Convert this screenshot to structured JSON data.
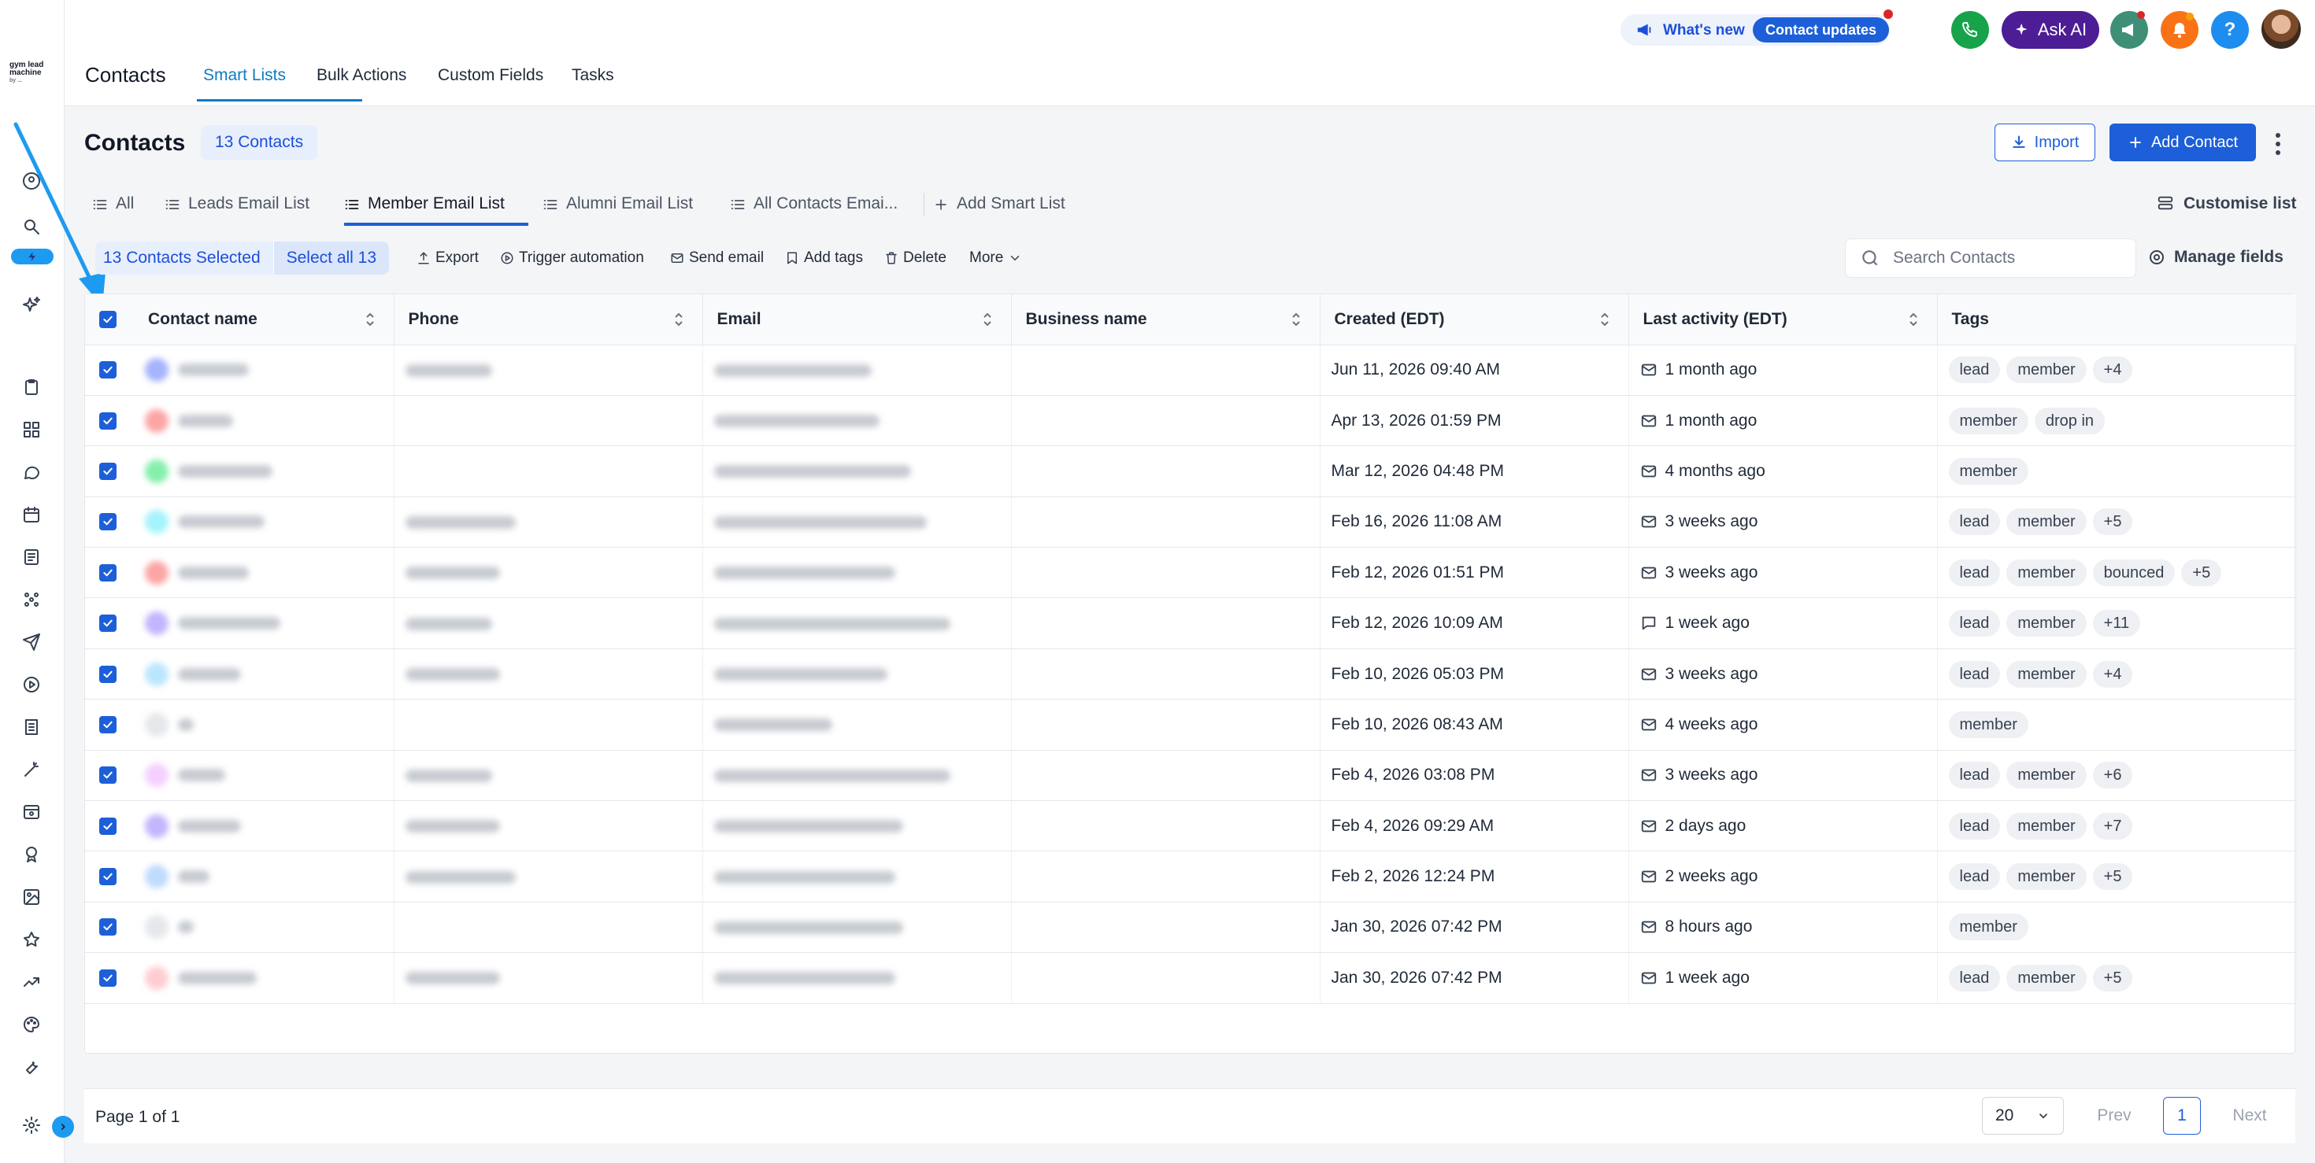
{
  "brand": {
    "logo_line1": "gym lead",
    "logo_line2": "machine",
    "logo_sub": "by ..."
  },
  "header": {
    "title": "Contacts",
    "tabs": [
      {
        "label": "Smart Lists",
        "active": true
      },
      {
        "label": "Bulk Actions"
      },
      {
        "label": "Custom Fields"
      },
      {
        "label": "Tasks"
      }
    ],
    "whats_new": "What's new",
    "contact_updates": "Contact updates",
    "ask_ai": "Ask AI",
    "colors": {
      "phone": "#16a34a",
      "ai": "#4c1d95",
      "megaphone": "#3f8f78",
      "bell": "#f97316",
      "help": "#1d8df0"
    }
  },
  "page": {
    "title": "Contacts",
    "count_badge": "13 Contacts",
    "import_label": "Import",
    "add_label": "Add Contact",
    "customise_label": "Customise list"
  },
  "smart_lists": [
    {
      "label": "All"
    },
    {
      "label": "Leads Email List"
    },
    {
      "label": "Member Email List",
      "active": true
    },
    {
      "label": "Alumni Email List"
    },
    {
      "label": "All Contacts Emai..."
    },
    {
      "label": "Add Smart List"
    }
  ],
  "actions": {
    "selected_label": "13 Contacts Selected",
    "select_all_label": "Select all 13",
    "export": "Export",
    "trigger_automation": "Trigger automation",
    "send_email": "Send email",
    "add_tags": "Add tags",
    "delete": "Delete",
    "more": "More",
    "search_placeholder": "Search Contacts",
    "manage_fields": "Manage fields"
  },
  "table": {
    "columns": [
      "Contact name",
      "Phone",
      "Email",
      "Business name",
      "Created (EDT)",
      "Last activity (EDT)",
      "Tags"
    ],
    "rows": [
      {
        "created": "Jun 11, 2026 09:40 AM",
        "activity": "1 month ago",
        "activity_icon": "mail-icon",
        "tags": [
          "lead",
          "member",
          "+4"
        ],
        "avatar": "#a5b4fc"
      },
      {
        "created": "Apr 13, 2026 01:59 PM",
        "activity": "1 month ago",
        "activity_icon": "mail-icon",
        "tags": [
          "member",
          "drop in"
        ],
        "avatar": "#fca5a5"
      },
      {
        "created": "Mar 12, 2026 04:48 PM",
        "activity": "4 months ago",
        "activity_icon": "mail-icon",
        "tags": [
          "member"
        ],
        "avatar": "#86efac"
      },
      {
        "created": "Feb 16, 2026 11:08 AM",
        "activity": "3 weeks ago",
        "activity_icon": "mail-icon",
        "tags": [
          "lead",
          "member",
          "+5"
        ],
        "avatar": "#a5f3fc"
      },
      {
        "created": "Feb 12, 2026 01:51 PM",
        "activity": "3 weeks ago",
        "activity_icon": "mail-icon",
        "tags": [
          "lead",
          "member",
          "bounced",
          "+5"
        ],
        "avatar": "#fca5a5"
      },
      {
        "created": "Feb 12, 2026 10:09 AM",
        "activity": "1 week ago",
        "activity_icon": "chat-icon",
        "tags": [
          "lead",
          "member",
          "+11"
        ],
        "avatar": "#c4b5fd"
      },
      {
        "created": "Feb 10, 2026 05:03 PM",
        "activity": "3 weeks ago",
        "activity_icon": "mail-icon",
        "tags": [
          "lead",
          "member",
          "+4"
        ],
        "avatar": "#bae6fd"
      },
      {
        "created": "Feb 10, 2026 08:43 AM",
        "activity": "4 weeks ago",
        "activity_icon": "mail-icon",
        "tags": [
          "member"
        ],
        "avatar": "#e5e7eb"
      },
      {
        "created": "Feb 4, 2026 03:08 PM",
        "activity": "3 weeks ago",
        "activity_icon": "mail-icon",
        "tags": [
          "lead",
          "member",
          "+6"
        ],
        "avatar": "#f5d0fe"
      },
      {
        "created": "Feb 4, 2026 09:29 AM",
        "activity": "2 days ago",
        "activity_icon": "mail-icon",
        "tags": [
          "lead",
          "member",
          "+7"
        ],
        "avatar": "#c4b5fd"
      },
      {
        "created": "Feb 2, 2026 12:24 PM",
        "activity": "2 weeks ago",
        "activity_icon": "mail-icon",
        "tags": [
          "lead",
          "member",
          "+5"
        ],
        "avatar": "#bfdbfe"
      },
      {
        "created": "Jan 30, 2026 07:42 PM",
        "activity": "8 hours ago",
        "activity_icon": "mail-icon",
        "tags": [
          "member"
        ],
        "avatar": "#e5e7eb"
      },
      {
        "created": "Jan 30, 2026 07:42 PM",
        "activity": "1 week ago",
        "activity_icon": "mail-icon",
        "tags": [
          "lead",
          "member",
          "+5"
        ],
        "avatar": "#fecdd3"
      }
    ]
  },
  "pagination": {
    "page_text": "Page 1 of 1",
    "per_page": "20",
    "prev": "Prev",
    "current": "1",
    "next": "Next"
  }
}
